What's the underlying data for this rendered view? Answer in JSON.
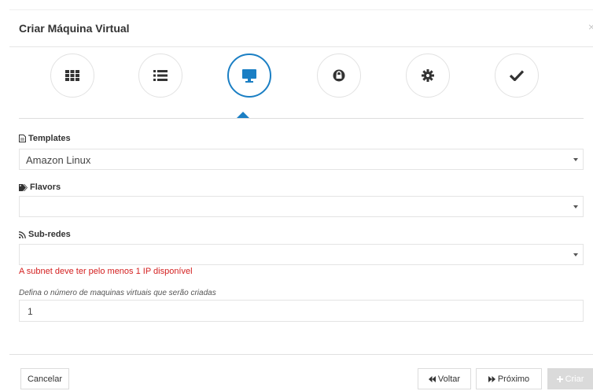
{
  "modal": {
    "title": "Criar Máquina Virtual",
    "close_symbol": "×"
  },
  "steps": [
    {
      "icon": "grid-icon",
      "active": false
    },
    {
      "icon": "list-icon",
      "active": false
    },
    {
      "icon": "monitor-icon",
      "active": true
    },
    {
      "icon": "lock-icon",
      "active": false
    },
    {
      "icon": "gear-icon",
      "active": false
    },
    {
      "icon": "checkmark-icon",
      "active": false
    }
  ],
  "form": {
    "templates": {
      "label": "Templates",
      "icon": "file-icon",
      "value": "Amazon Linux"
    },
    "flavors": {
      "label": "Flavors",
      "icon": "tags-icon",
      "value": ""
    },
    "subnets": {
      "label": "Sub-redes",
      "icon": "rss-icon",
      "value": "",
      "error": "A subnet deve ter pelo menos 1 IP disponível"
    },
    "vm_count": {
      "hint": "Defina o número de maquinas virtuais que serão criadas",
      "value": "1"
    }
  },
  "footer": {
    "cancel_label": "Cancelar",
    "back_label": "Voltar",
    "next_label": "Próximo",
    "create_label": "Criar"
  },
  "colors": {
    "accent": "#1b7fc4",
    "error": "#d42020",
    "disabled_button": "#dadada"
  }
}
